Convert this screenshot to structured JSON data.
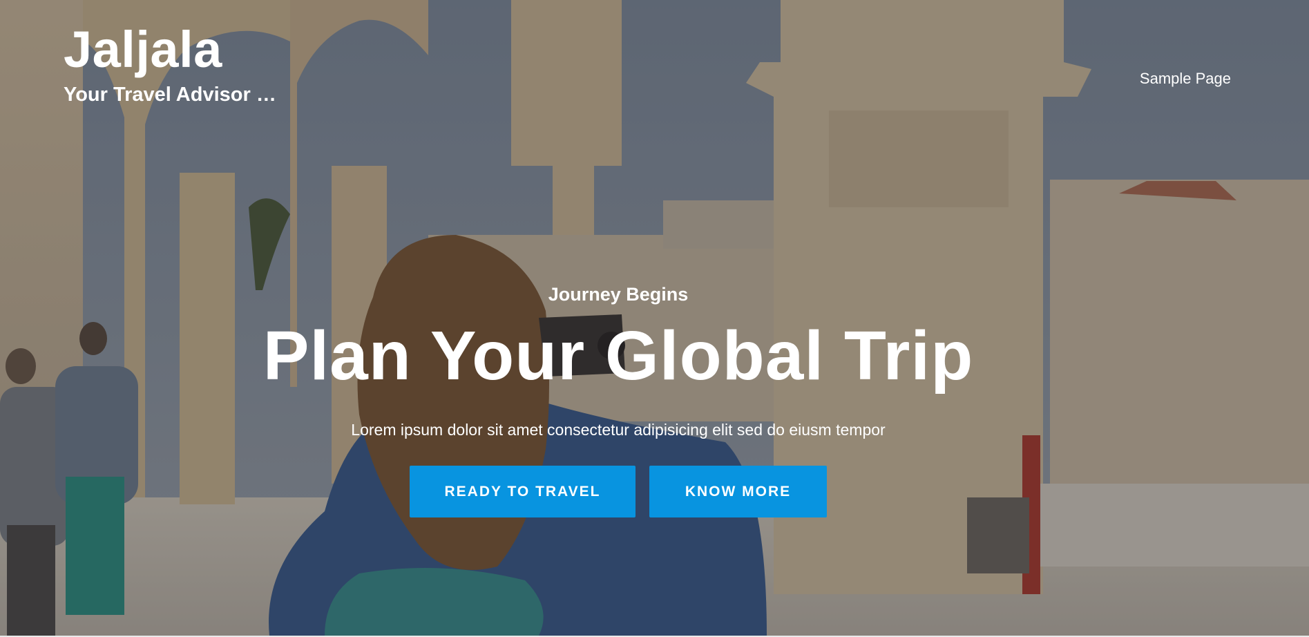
{
  "header": {
    "site_title": "Jaljala",
    "tagline": "Your Travel Advisor …"
  },
  "nav": {
    "items": [
      {
        "label": "Sample Page"
      }
    ]
  },
  "hero": {
    "eyebrow": "Journey Begins",
    "headline": "Plan Your Global Trip",
    "lead": "Lorem ipsum dolor sit amet consectetur adipisicing elit sed do eiusm tempor",
    "primary_button": "READY TO TRAVEL",
    "secondary_button": "KNOW MORE",
    "background_image": "photo of a traveler taking a picture among ancient stone arches",
    "overlay_color": "#14161e",
    "button_color": "#0894e0"
  }
}
